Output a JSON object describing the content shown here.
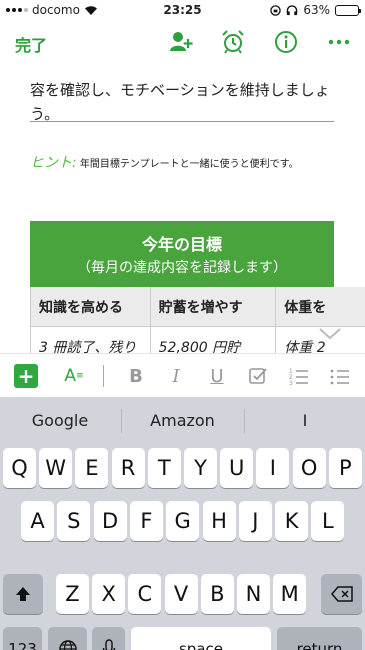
{
  "status": {
    "carrier": "docomo",
    "time": "23:25",
    "battery": "63%",
    "battery_level": 0.63
  },
  "nav": {
    "done_label": "完了",
    "icons": [
      "add-person-icon",
      "alarm-icon",
      "info-icon",
      "more-icon"
    ]
  },
  "note": {
    "body_lines": [
      "容を確認し、モチベーションを維持しましょう。"
    ],
    "hint_label": "ヒント:",
    "hint_text": "年間目標テンプレートと一緒に使うと便利です。"
  },
  "table": {
    "title": "今年の目標",
    "subtitle": "（毎月の達成内容を記録します）",
    "columns": [
      "知識を高める",
      "貯蓄を増やす",
      "体重を"
    ],
    "row1": [
      "3 冊読了、残り",
      "52,800 円貯",
      "体重 2"
    ]
  },
  "format_bar": {
    "icons": [
      "plus-icon",
      "text-style-icon",
      "bold-icon",
      "italic-icon",
      "underline-icon",
      "checkbox-icon",
      "numbered-list-icon",
      "bullet-list-icon"
    ],
    "bold": "B",
    "italic": "I",
    "underline": "U"
  },
  "keyboard": {
    "suggestions": [
      "Google",
      "Amazon",
      "I"
    ],
    "row1": [
      "Q",
      "W",
      "E",
      "R",
      "T",
      "Y",
      "U",
      "I",
      "O",
      "P"
    ],
    "row2": [
      "A",
      "S",
      "D",
      "F",
      "G",
      "H",
      "J",
      "K",
      "L"
    ],
    "row3": [
      "Z",
      "X",
      "C",
      "V",
      "B",
      "N",
      "M"
    ],
    "numbers_label": "123",
    "space_label": "space",
    "return_label": "return"
  },
  "colors": {
    "accent": "#2e9e3e",
    "table_header": "#4aa43e",
    "keyboard_bg": "#d1d4da"
  }
}
